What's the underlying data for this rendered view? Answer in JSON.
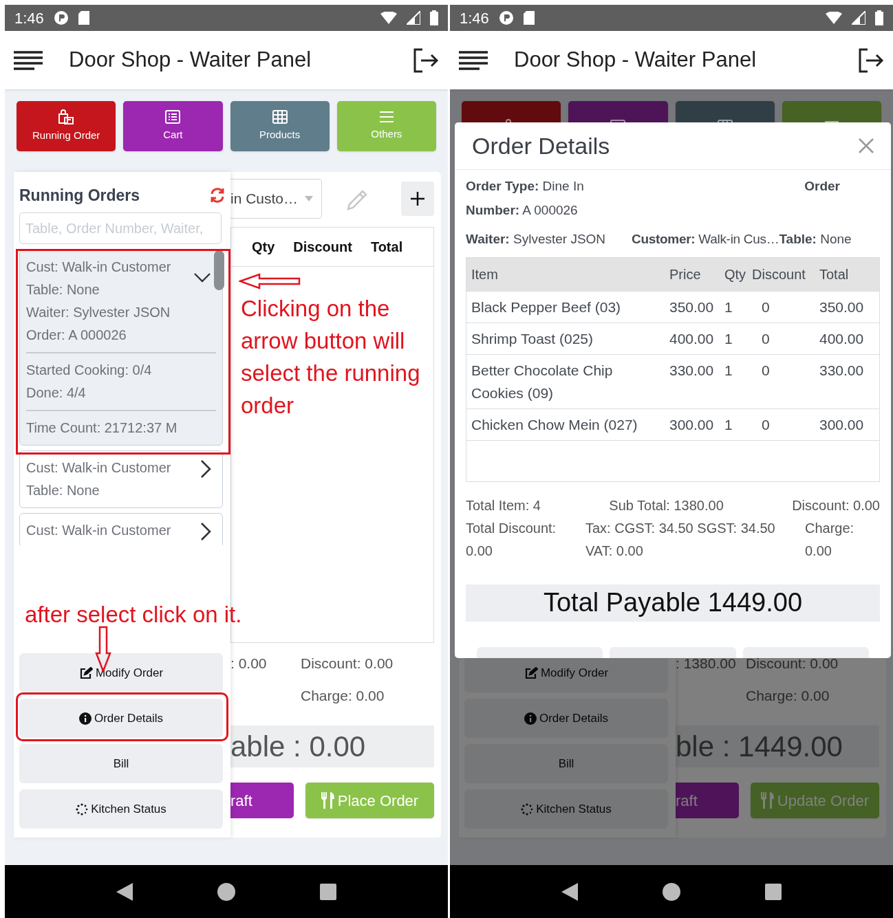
{
  "screens": [
    {
      "status_time": "1:46",
      "app_title": "Door Shop - Waiter Panel",
      "nav_buttons": [
        {
          "kind": "running",
          "label": "Running Order",
          "color": "#c4161c"
        },
        {
          "kind": "cart",
          "label": "Cart",
          "color": "#9c27b0"
        },
        {
          "kind": "products",
          "label": "Products",
          "color": "#607d8b"
        },
        {
          "kind": "others",
          "label": "Others",
          "color": "#8bc34a"
        }
      ],
      "running_orders": {
        "title": "Running Orders",
        "search_placeholder": "Table, Order Number, Waiter,",
        "orders": [
          {
            "expanded": true,
            "sections": [
              [
                "Cust: Walk-in Customer",
                "Table: None",
                "Waiter: Sylvester JSON",
                "Order: A 000026"
              ],
              [
                "Started Cooking: 0/4",
                "Done: 4/4"
              ],
              [
                "Time Count: 21712:37 M"
              ]
            ]
          },
          {
            "expanded": false,
            "sections": [
              [
                "Cust: Walk-in Customer",
                "Table: None"
              ]
            ]
          },
          {
            "expanded": false,
            "sections": [
              [
                "Cust: Walk-in Customer"
              ]
            ]
          }
        ]
      },
      "actions": [
        {
          "kind": "edit",
          "label": "Modify Order"
        },
        {
          "kind": "info",
          "label": "Order Details"
        },
        {
          "kind": "plain",
          "label": "Bill"
        },
        {
          "kind": "spinner",
          "label": "Kitchen Status"
        }
      ],
      "cart": {
        "customer_select": "in Custo…",
        "columns": [
          "Qty",
          "Discount",
          "Total"
        ]
      },
      "summary": {
        "sub_total": ": 0.00",
        "discount": "Discount: 0.00",
        "charge": "Charge: 0.00",
        "payable": "able : 0.00",
        "draft_button": "raft",
        "order_button": "Place Order"
      },
      "annotations": {
        "arrow_note": "Clicking on the arrow button will select the running order",
        "click_note": "after select click on it."
      }
    },
    {
      "status_time": "1:46",
      "app_title": "Door Shop - Waiter Panel",
      "nav_buttons": [
        {
          "kind": "running",
          "color": "#620b0e"
        },
        {
          "kind": "cart",
          "color": "#4e1458"
        },
        {
          "kind": "products",
          "color": "#303f46"
        },
        {
          "kind": "others",
          "color": "#466225"
        }
      ],
      "actions": [
        {
          "kind": "edit",
          "label": "Modify Order"
        },
        {
          "kind": "info",
          "label": "Order Details"
        },
        {
          "kind": "plain",
          "label": "Bill"
        },
        {
          "kind": "spinner",
          "label": "Kitchen Status"
        }
      ],
      "summary": {
        "sub_total": ": 1380.00",
        "discount": "Discount: 0.00",
        "charge": "Charge: 0.00",
        "payable": "ble : 1449.00",
        "draft_button": "raft",
        "order_button": "Update Order"
      },
      "modal": {
        "title": "Order Details",
        "order_type": "**Order Type:** Dine In",
        "order_label": "Order",
        "order_number": "**Number:** A 000026",
        "waiter": "**Waiter:** Sylvester JSON",
        "customer": "**Customer:** Walk-in Cus…",
        "table": "**Table:** None",
        "columns": [
          "Item",
          "Price",
          "Qty",
          "Discount",
          "Total"
        ],
        "rows": [
          [
            "Black Pepper Beef (03)",
            "350.00",
            "1",
            "0",
            "350.00"
          ],
          [
            "Shrimp Toast (025)",
            "400.00",
            "1",
            "0",
            "400.00"
          ],
          [
            "Better Chocolate Chip Cookies (09)",
            "330.00",
            "1",
            "0",
            "330.00"
          ],
          [
            "Chicken Chow Mein (027)",
            "300.00",
            "1",
            "0",
            "300.00"
          ]
        ],
        "totals": [
          "Total Item: 4",
          "Sub Total: 1380.00",
          "Discount: 0.00",
          "Total Discount: 0.00",
          "Tax: CGST: 34.50 SGST: 34.50 VAT: 0.00",
          "Charge: 0.00"
        ],
        "payable": "Total Payable 1449.00"
      }
    }
  ]
}
